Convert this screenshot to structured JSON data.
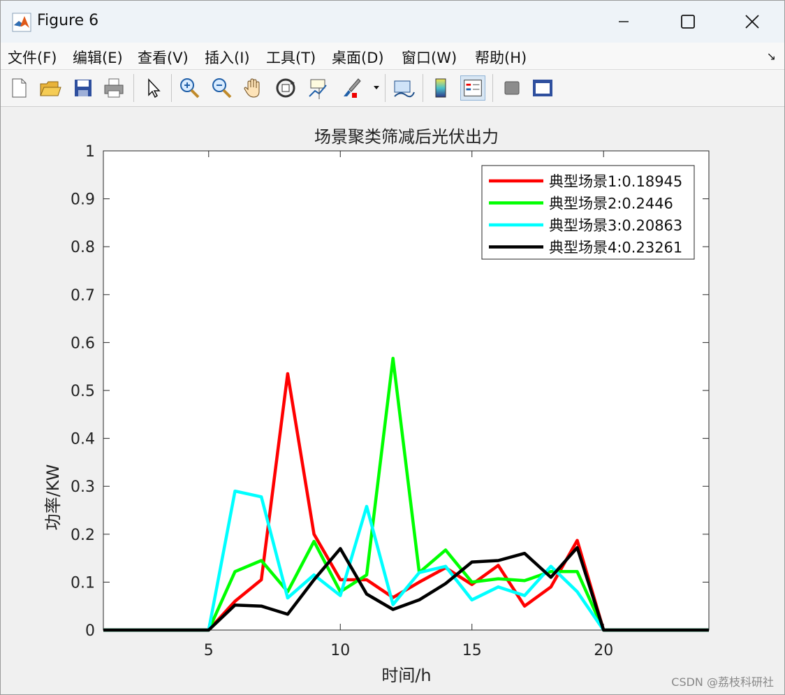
{
  "window": {
    "title": "Figure 6"
  },
  "menu": [
    {
      "label": "文件(F)"
    },
    {
      "label": "编辑(E)"
    },
    {
      "label": "查看(V)"
    },
    {
      "label": "插入(I)"
    },
    {
      "label": "工具(T)"
    },
    {
      "label": "桌面(D)"
    },
    {
      "label": "窗口(W)"
    },
    {
      "label": "帮助(H)"
    }
  ],
  "toolbar": {
    "icons": [
      "new-figure-icon",
      "open-file-icon",
      "save-icon",
      "print-icon",
      "select-arrow-icon",
      "zoom-in-icon",
      "zoom-out-icon",
      "pan-hand-icon",
      "rotate-3d-icon",
      "data-cursor-icon",
      "brush-icon",
      "link-plot-icon",
      "colorbar-icon",
      "legend-icon",
      "hide-plot-tools-icon",
      "show-plot-tools-icon"
    ],
    "active": "legend-icon"
  },
  "chart_data": {
    "type": "line",
    "title": "场景聚类筛减后光伏出力",
    "xlabel": "时间/h",
    "ylabel": "功率/KW",
    "xlim": [
      1,
      24
    ],
    "ylim": [
      0,
      1
    ],
    "xticks": [
      5,
      10,
      15,
      20
    ],
    "yticks": [
      0,
      0.1,
      0.2,
      0.3,
      0.4,
      0.5,
      0.6,
      0.7,
      0.8,
      0.9,
      1
    ],
    "ytick_labels": [
      "0",
      "0.1",
      "0.2",
      "0.3",
      "0.4",
      "0.5",
      "0.6",
      "0.7",
      "0.8",
      "0.9",
      "1"
    ],
    "legend_position": "top-right",
    "x": [
      1,
      2,
      3,
      4,
      5,
      6,
      7,
      8,
      9,
      10,
      11,
      12,
      13,
      14,
      15,
      16,
      17,
      18,
      19,
      20,
      21,
      22,
      23,
      24
    ],
    "series": [
      {
        "name": "典型场景1:0.18945",
        "color": "#ff0000",
        "values": [
          0,
          0,
          0,
          0,
          0,
          0.06,
          0.105,
          0.535,
          0.2,
          0.105,
          0.105,
          0.068,
          0.1,
          0.13,
          0.095,
          0.135,
          0.05,
          0.09,
          0.187,
          0,
          0,
          0,
          0,
          0
        ]
      },
      {
        "name": "典型场景2:0.2446",
        "color": "#00ff00",
        "values": [
          0,
          0,
          0,
          0,
          0,
          0.122,
          0.145,
          0.08,
          0.185,
          0.08,
          0.115,
          0.567,
          0.12,
          0.167,
          0.1,
          0.107,
          0.103,
          0.122,
          0.122,
          0,
          0,
          0,
          0,
          0
        ]
      },
      {
        "name": "典型场景3:0.20863",
        "color": "#00ffff",
        "values": [
          0,
          0,
          0,
          0,
          0,
          0.29,
          0.278,
          0.067,
          0.115,
          0.072,
          0.258,
          0.053,
          0.12,
          0.133,
          0.063,
          0.09,
          0.072,
          0.133,
          0.08,
          0,
          0,
          0,
          0,
          0
        ]
      },
      {
        "name": "典型场景4:0.23261",
        "color": "#000000",
        "values": [
          0,
          0,
          0,
          0,
          0,
          0.052,
          0.05,
          0.033,
          0.105,
          0.17,
          0.075,
          0.043,
          0.063,
          0.097,
          0.142,
          0.145,
          0.16,
          0.11,
          0.172,
          0,
          0,
          0,
          0,
          0
        ]
      }
    ]
  },
  "watermark": "CSDN @荔枝科研社"
}
